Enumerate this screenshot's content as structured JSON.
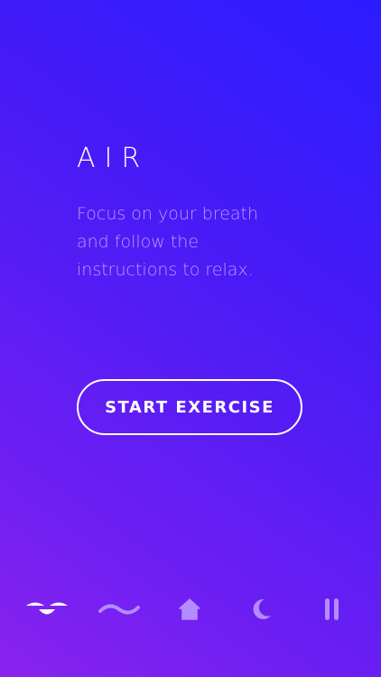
{
  "screen": {
    "title": "AIR",
    "description_lines": [
      "Focus on your breath",
      "and follow the",
      "instructions to relax."
    ],
    "start_button_label": "START EXERCISE"
  },
  "tabbar": {
    "items": [
      {
        "icon": "air-icon",
        "active": true
      },
      {
        "icon": "wave-icon",
        "active": false
      },
      {
        "icon": "home-icon",
        "active": false
      },
      {
        "icon": "moon-icon",
        "active": false
      },
      {
        "icon": "pause-icon",
        "active": false
      }
    ]
  },
  "colors": {
    "gradient_top": "#2a1cff",
    "gradient_bottom": "#8a22f0",
    "active_icon": "#ffffff",
    "inactive_icon": "#b58cff"
  }
}
